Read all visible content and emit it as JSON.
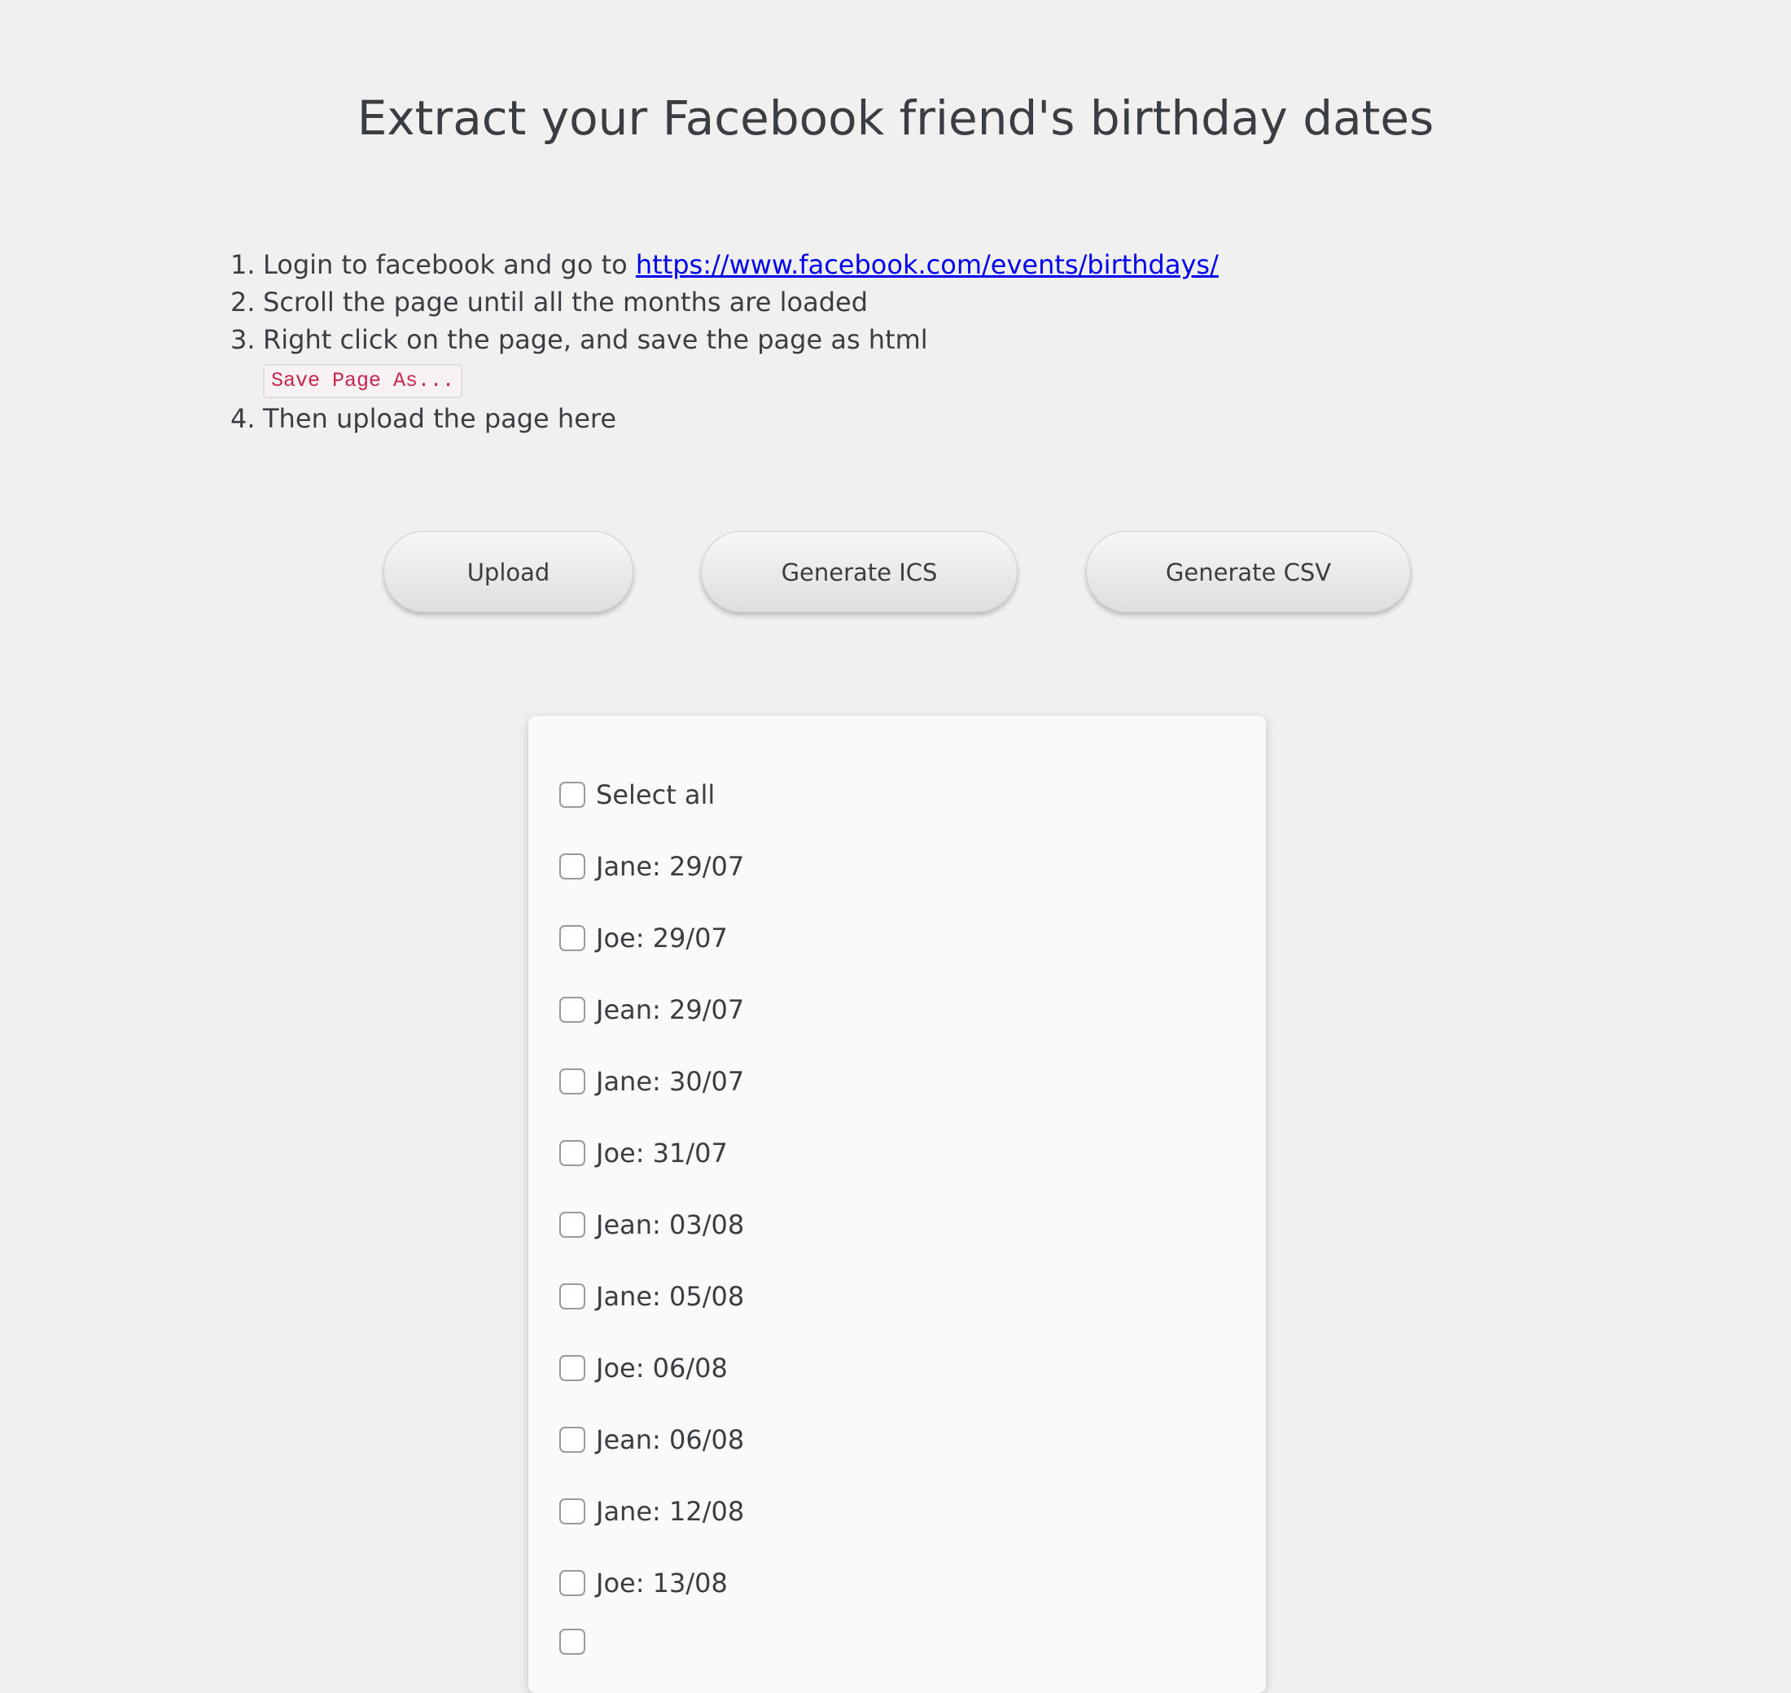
{
  "page": {
    "title": "Extract your Facebook friend's birthday dates"
  },
  "instructions": [
    {
      "number": "1.",
      "text_before": "Login to facebook and go to ",
      "link": "https://www.facebook.com/events/birthdays/"
    },
    {
      "number": "2.",
      "text": "Scroll the page until all the months are loaded"
    },
    {
      "number": "3.",
      "text": "Right click on the page, and save the page as html",
      "code": "Save Page As..."
    },
    {
      "number": "4.",
      "text": "Then upload the page here"
    }
  ],
  "buttons": {
    "upload": "Upload",
    "generate_ics": "Generate ICS",
    "generate_csv": "Generate CSV"
  },
  "list": {
    "select_all": "Select all",
    "items": [
      {
        "name": "Jane",
        "date": "29/07",
        "label": "Jane: 29/07",
        "checked": false
      },
      {
        "name": "Joe",
        "date": "29/07",
        "label": "Joe: 29/07",
        "checked": false
      },
      {
        "name": "Jean",
        "date": "29/07",
        "label": "Jean: 29/07",
        "checked": false
      },
      {
        "name": "Jane",
        "date": "30/07",
        "label": "Jane: 30/07",
        "checked": false
      },
      {
        "name": "Joe",
        "date": "31/07",
        "label": "Joe: 31/07",
        "checked": false
      },
      {
        "name": "Jean",
        "date": "03/08",
        "label": "Jean: 03/08",
        "checked": false
      },
      {
        "name": "Jane",
        "date": "05/08",
        "label": "Jane: 05/08",
        "checked": false
      },
      {
        "name": "Joe",
        "date": "06/08",
        "label": "Joe: 06/08",
        "checked": false
      },
      {
        "name": "Jean",
        "date": "06/08",
        "label": "Jean: 06/08",
        "checked": false
      },
      {
        "name": "Jane",
        "date": "12/08",
        "label": "Jane: 12/08",
        "checked": false
      },
      {
        "name": "Joe",
        "date": "13/08",
        "label": "Joe: 13/08",
        "checked": false
      }
    ]
  },
  "colors": {
    "background": "#f0f0f0",
    "text": "#3a3d42",
    "link": "#0000ee",
    "code_text": "#c7254e",
    "card_background": "#fafafa"
  }
}
